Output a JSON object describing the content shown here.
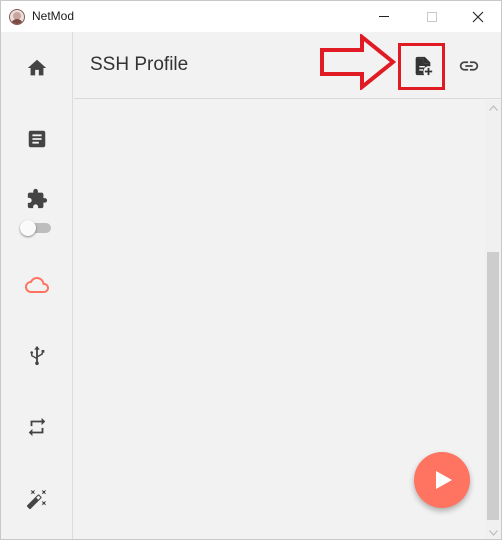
{
  "window": {
    "title": "NetMod"
  },
  "header": {
    "title": "SSH Profile",
    "actions": [
      {
        "name": "new-profile",
        "icon": "file-plus-icon"
      },
      {
        "name": "link",
        "icon": "link-icon"
      }
    ]
  },
  "sidebar": {
    "items": [
      {
        "id": "home",
        "icon": "home-icon",
        "active": false
      },
      {
        "id": "notes",
        "icon": "note-icon",
        "active": false
      },
      {
        "id": "extensions",
        "icon": "puzzle-icon",
        "active": false
      },
      {
        "id": "cloud",
        "icon": "cloud-icon",
        "active": true
      },
      {
        "id": "usb",
        "icon": "usb-icon",
        "active": false
      },
      {
        "id": "repeat",
        "icon": "repeat-icon",
        "active": false
      },
      {
        "id": "magic",
        "icon": "magic-wand-icon",
        "active": false
      }
    ],
    "toggle": {
      "on": false
    }
  },
  "fab": {
    "icon": "play-icon"
  },
  "colors": {
    "accent": "#ff7361",
    "annotation": "#e01b24",
    "icon": "#444444",
    "background": "#f2f2f2"
  }
}
